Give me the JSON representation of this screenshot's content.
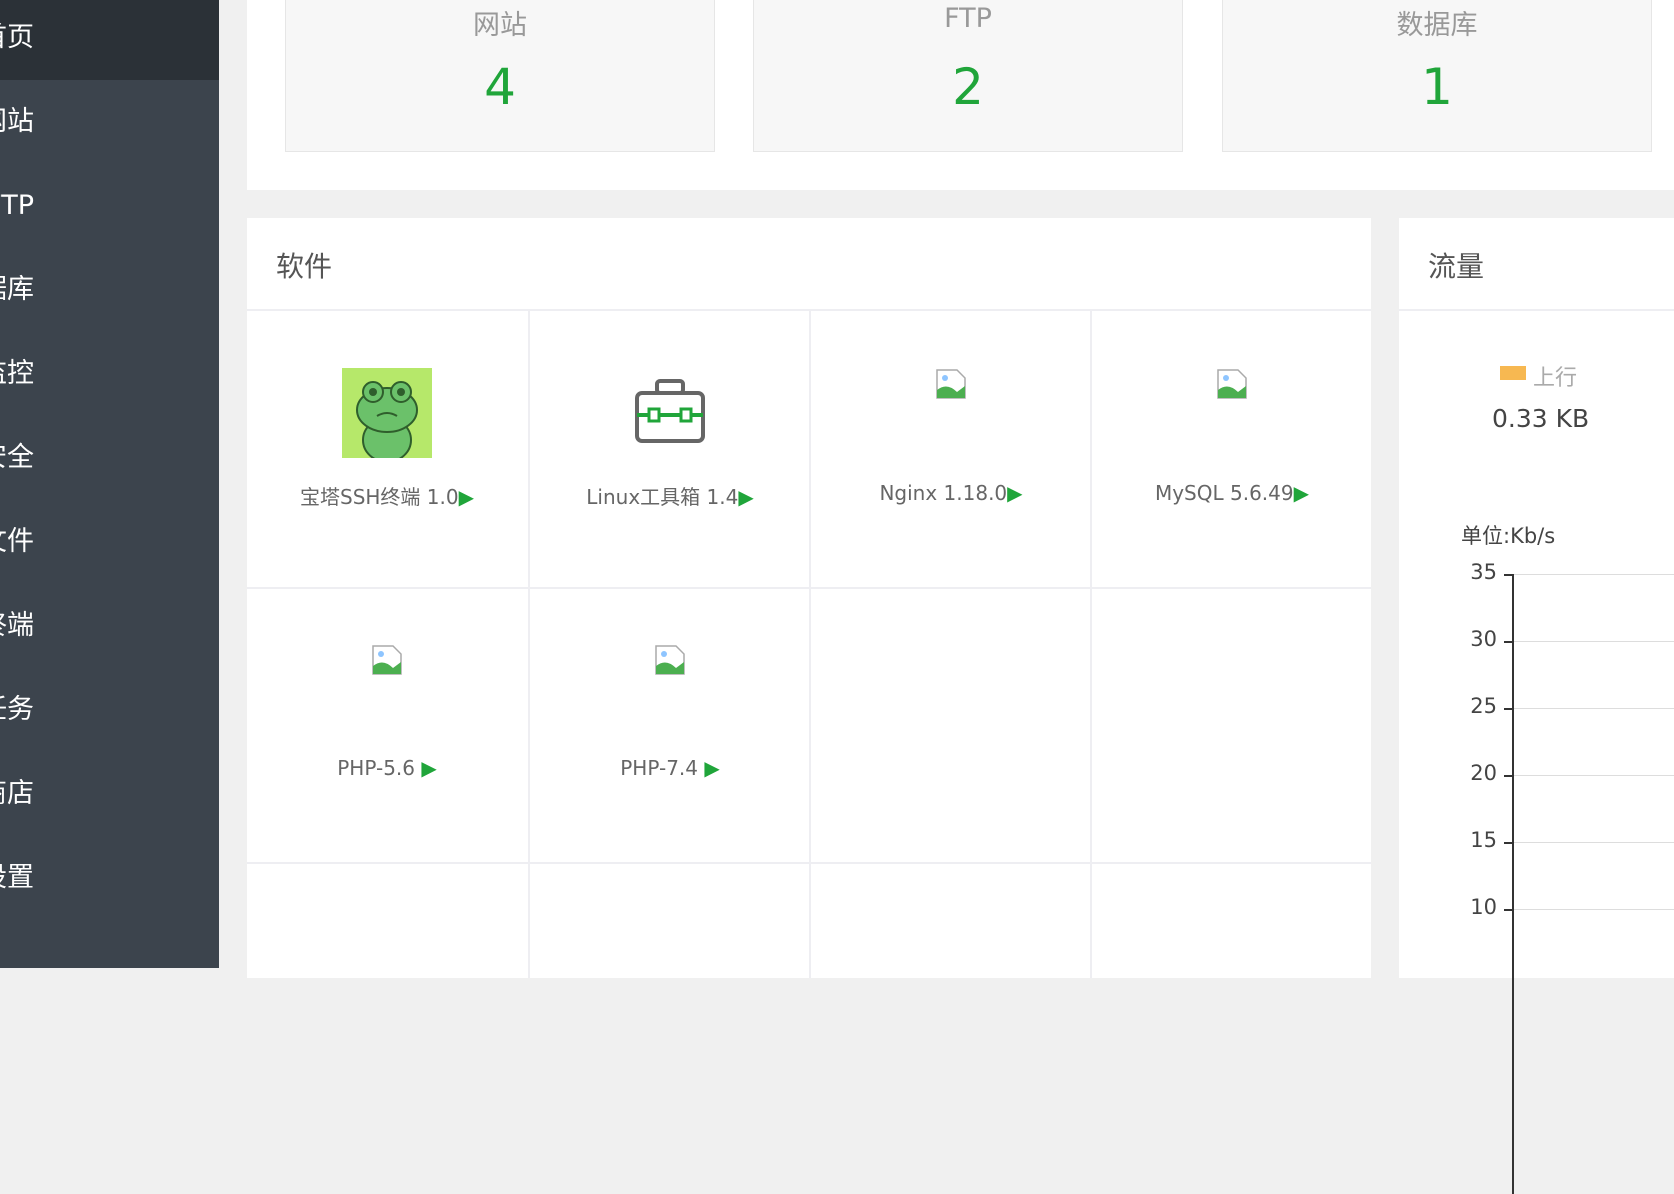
{
  "sidebar": {
    "items": [
      {
        "label": "首页",
        "active": true
      },
      {
        "label": "网站"
      },
      {
        "label": "FTP"
      },
      {
        "label": "数据库"
      },
      {
        "label": "监控"
      },
      {
        "label": "安全"
      },
      {
        "label": "文件"
      },
      {
        "label": "终端"
      },
      {
        "label": "计划任务"
      },
      {
        "label": "软件商店"
      },
      {
        "label": "面板设置"
      }
    ]
  },
  "stats": [
    {
      "label": "网站",
      "value": "4"
    },
    {
      "label": "FTP",
      "value": "2"
    },
    {
      "label": "数据库",
      "value": "1"
    }
  ],
  "software": {
    "title": "软件",
    "items": [
      {
        "name": "宝塔SSH终端 1.0",
        "icon": "frog-icon"
      },
      {
        "name": "Linux工具箱 1.4",
        "icon": "toolbox-icon"
      },
      {
        "name": "Nginx 1.18.0",
        "icon": "broken-image-icon"
      },
      {
        "name": "MySQL 5.6.49",
        "icon": "broken-image-icon"
      },
      {
        "name": "PHP-5.6 ",
        "icon": "broken-image-icon"
      },
      {
        "name": "PHP-7.4 ",
        "icon": "broken-image-icon"
      }
    ],
    "play_glyph": "▶"
  },
  "flow": {
    "title": "流量",
    "legend_upstream": "上行",
    "upstream_value": "0.33 KB",
    "unit": "单位:Kb/s",
    "y_ticks": [
      "35",
      "30",
      "25",
      "20",
      "15",
      "10"
    ],
    "legend_color": "#f7b851"
  },
  "colors": {
    "accent": "#20a53a",
    "sidebar_bg": "#3c444d",
    "sidebar_active": "#2b3137"
  }
}
